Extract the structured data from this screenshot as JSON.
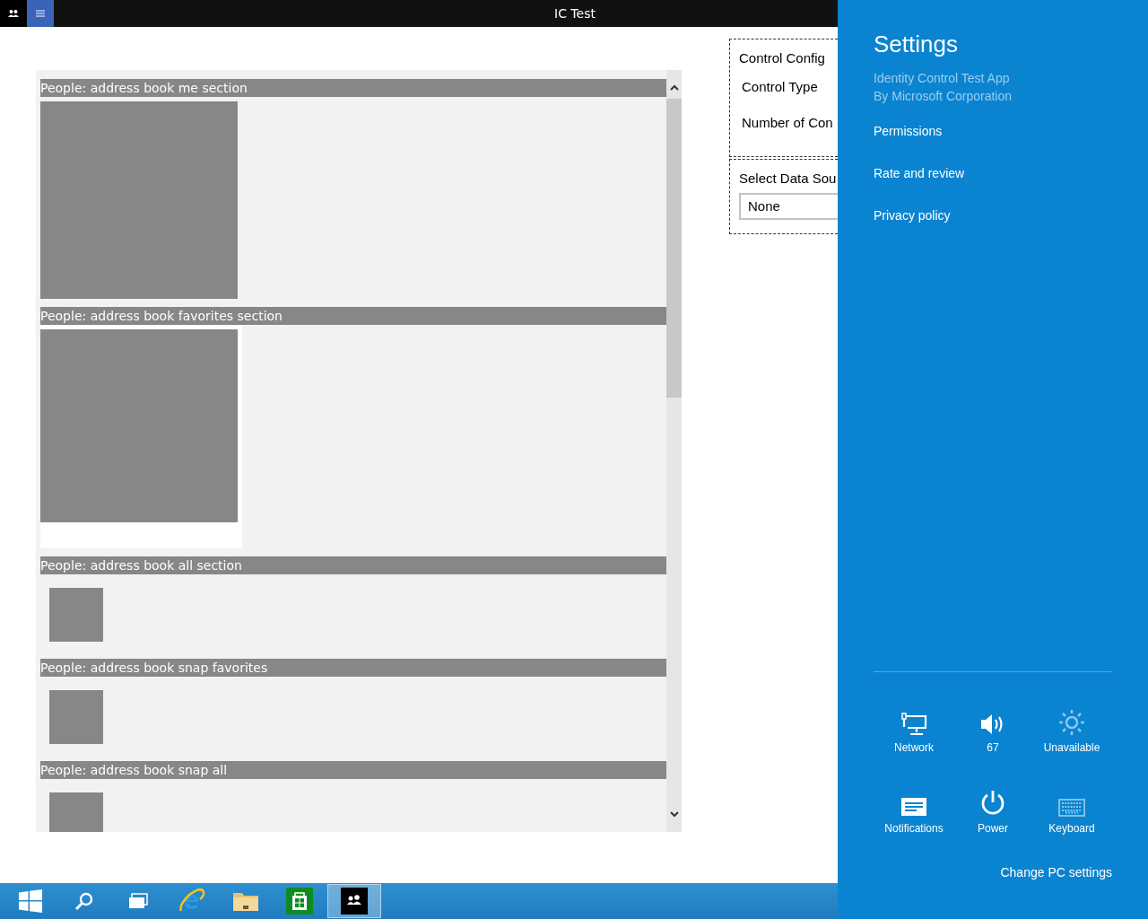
{
  "title_bar": {
    "title": "IC Test",
    "buttons": [
      {
        "kind": "people",
        "selected": false
      },
      {
        "kind": "menu",
        "selected": true
      }
    ]
  },
  "list": {
    "sections": [
      {
        "title": "People: address book me section",
        "kind": "large",
        "selected": false
      },
      {
        "title": "People: address book favorites section",
        "kind": "large",
        "selected": true
      },
      {
        "title": "People: address book all section",
        "kind": "small",
        "selected": false
      },
      {
        "title": "People: address book snap favorites",
        "kind": "small",
        "selected": false
      },
      {
        "title": "People: address book snap all",
        "kind": "small",
        "selected": false
      }
    ]
  },
  "config": {
    "heading": "Control Config",
    "fields": [
      "Control Type",
      "Number of Con"
    ]
  },
  "data_source": {
    "heading": "Select Data Sou",
    "value": "None"
  },
  "taskbar": {
    "items": [
      {
        "kind": "start",
        "selected": false
      },
      {
        "kind": "search",
        "selected": false
      },
      {
        "kind": "taskview",
        "selected": false
      },
      {
        "kind": "browser",
        "selected": false
      },
      {
        "kind": "folder",
        "selected": false
      },
      {
        "kind": "store",
        "selected": false
      },
      {
        "kind": "people",
        "selected": true
      }
    ]
  },
  "settings": {
    "title": "Settings",
    "app_name": "Identity Control Test App",
    "publisher": "By Microsoft Corporation",
    "links": [
      "Permissions",
      "Rate and review",
      "Privacy policy"
    ],
    "quick": [
      {
        "kind": "network",
        "label": "Network",
        "disabled": false
      },
      {
        "kind": "volume",
        "label": "67",
        "disabled": false
      },
      {
        "kind": "brightness",
        "label": "Unavailable",
        "disabled": true
      },
      {
        "kind": "notifications",
        "label": "Notifications",
        "disabled": false
      },
      {
        "kind": "power",
        "label": "Power",
        "disabled": false
      },
      {
        "kind": "keyboard",
        "label": "Keyboard",
        "disabled": true
      }
    ],
    "footer_link": "Change PC settings"
  }
}
